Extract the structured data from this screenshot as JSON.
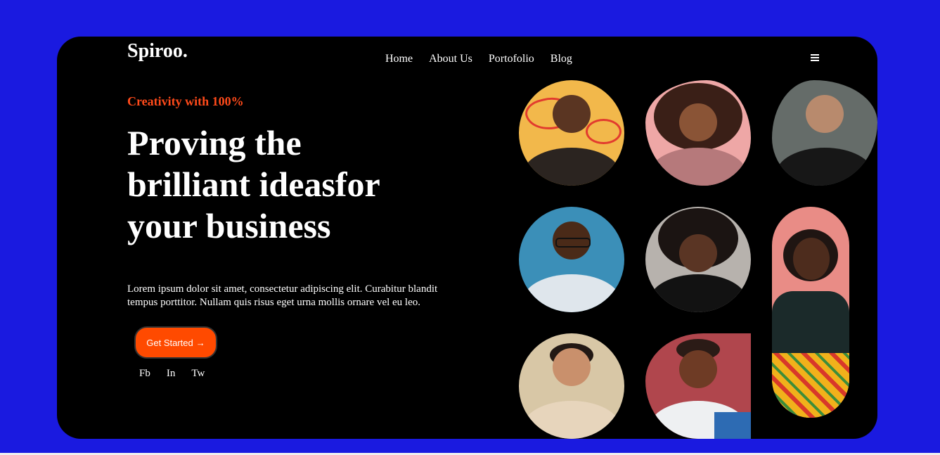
{
  "brand": {
    "name": "Spiroo."
  },
  "nav": {
    "items": [
      {
        "label": "Home"
      },
      {
        "label": "About Us"
      },
      {
        "label": "Portofolio"
      },
      {
        "label": "Blog"
      }
    ]
  },
  "hero": {
    "eyebrow": "Creativity with 100%",
    "headline_line1": "Proving the",
    "headline_line2": "brilliant ideasfor",
    "headline_line3": "your business",
    "body": "Lorem ipsum dolor sit amet, consectetur adipiscing elit. Curabitur blandit tempus porttitor. Nullam quis risus eget urna mollis ornare vel eu leo.",
    "cta_label": "Get Started",
    "cta_arrow": "→"
  },
  "socials": {
    "items": [
      {
        "label": "Fb"
      },
      {
        "label": "In"
      },
      {
        "label": "Tw"
      }
    ]
  },
  "colors": {
    "page_background": "#1a1ae0",
    "card_background": "#000000",
    "accent": "#ff4a00"
  },
  "icons": {
    "menu": "hamburger-menu-icon",
    "arrow": "arrow-right-icon"
  }
}
